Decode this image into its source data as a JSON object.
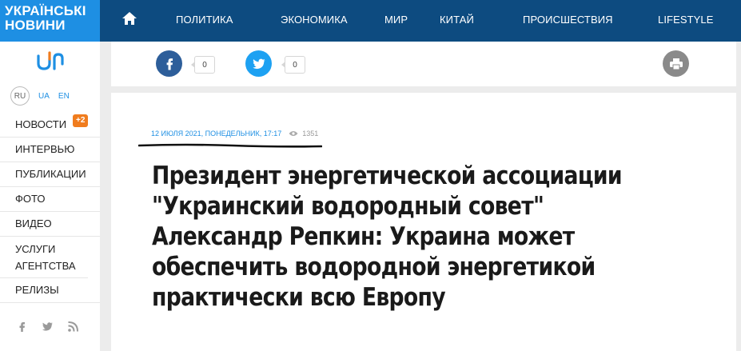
{
  "brand": {
    "line1": "УКРАЇНСЬКІ",
    "line2": "НОВИНИ"
  },
  "nav": {
    "items": [
      "ПОЛИТИКА",
      "ЭКОНОМИКА",
      "МИР",
      "КИТАЙ",
      "ПРОИСШЕСТВИЯ",
      "LIFESTYLE"
    ]
  },
  "languages": {
    "ru": "RU",
    "ua": "UA",
    "en": "EN"
  },
  "sidebar": {
    "items": [
      {
        "label": "НОВОСТИ",
        "badge": "+2"
      },
      {
        "label": "ИНТЕРВЬЮ"
      },
      {
        "label": "ПУБЛИКАЦИИ"
      },
      {
        "label": "ФОТО"
      },
      {
        "label": "ВИДЕО"
      },
      {
        "label": "УСЛУГИ АГЕНТСТВА"
      },
      {
        "label": "РЕЛИЗЫ"
      }
    ],
    "social_icons": [
      "facebook-icon",
      "twitter-icon",
      "rss-icon"
    ]
  },
  "share": {
    "facebook_count": "0",
    "twitter_count": "0"
  },
  "article": {
    "meta": "12 ИЮЛЯ 2021, ПОНЕДЕЛЬНИК, 17:17",
    "views": "1351",
    "title": "Президент энергетической ассоциации \"Украинский водородный совет\" Александр Репкин: Украина может обеспечить водородной энергетикой практически всю Европу"
  },
  "colors": {
    "brand": "#1e8fe3",
    "nav": "#0d4b80",
    "badge": "#f07c1e",
    "facebook": "#2d5e9a",
    "twitter": "#1da1f2"
  }
}
